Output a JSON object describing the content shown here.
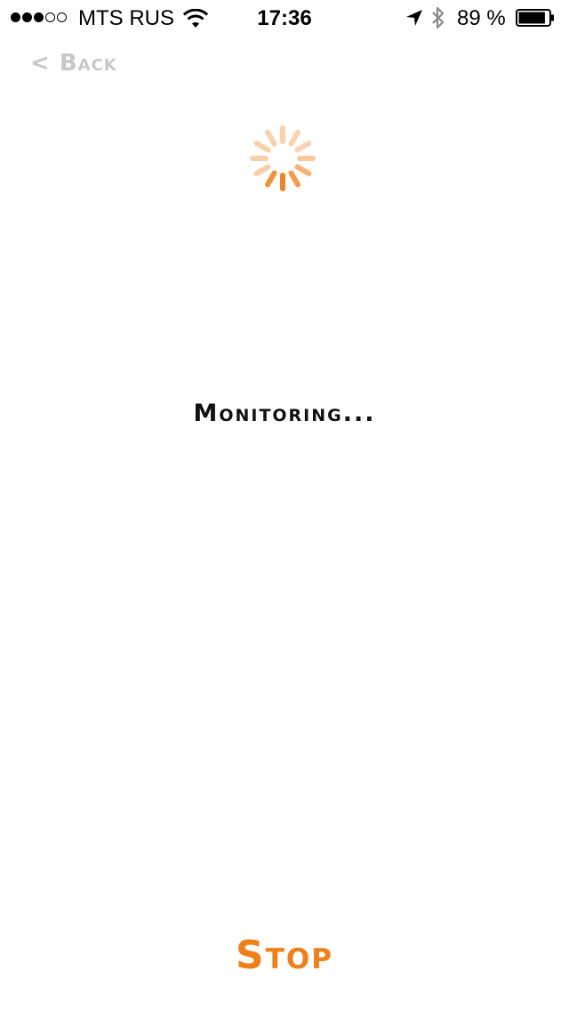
{
  "status_bar": {
    "signal_filled": 3,
    "signal_total": 5,
    "carrier": "MTS RUS",
    "time": "17:36",
    "battery_percent": "89 %",
    "battery_level": 0.89,
    "icons": [
      "wifi-icon",
      "location-arrow-icon",
      "bluetooth-icon",
      "battery-icon"
    ]
  },
  "nav": {
    "back_label": "< Back"
  },
  "main": {
    "status_text": "Monitoring...",
    "spinner_icon": "activity-spinner-icon"
  },
  "footer": {
    "stop_label": "Stop"
  },
  "colors": {
    "accent": "#f07f18",
    "back_text": "#c8c8c8",
    "background": "#ffffff"
  }
}
